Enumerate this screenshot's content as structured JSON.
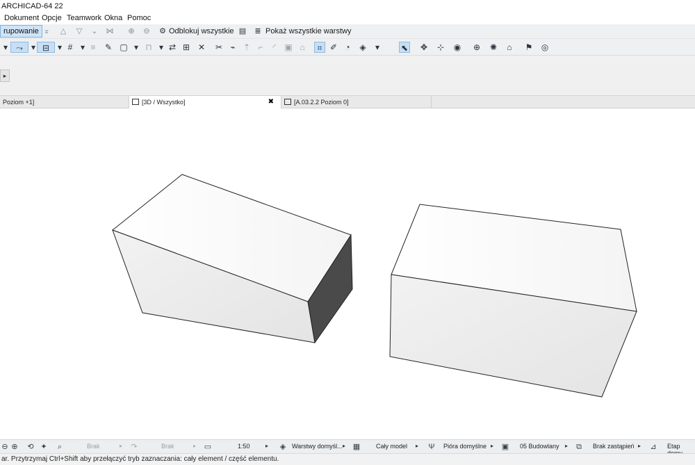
{
  "window": {
    "title": "ARCHICAD-64 22"
  },
  "menu": [
    "Dokument",
    "Opcje",
    "Teamwork",
    "Okna",
    "Pomoc"
  ],
  "toolbar1": {
    "group_button": "rupowanie",
    "unlock_all": "Odblokuj wszystkie",
    "show_all_layers": "Pokaż wszystkie warstwy"
  },
  "tabs": [
    {
      "label": "Poziom +1]",
      "active": false
    },
    {
      "label": "[3D / Wszystko]",
      "active": true,
      "close": "✖"
    },
    {
      "label": "[A.03.2.2 Poziom 0]",
      "active": false
    }
  ],
  "status": {
    "undo_field": "Brak",
    "redo_field": "Brak",
    "scale": "1:50",
    "layers": "Warstwy domyśl...",
    "model": "Cały model",
    "pens": "Pióra domyślne",
    "structure": "05 Budowlany",
    "override": "Brak zastąpień",
    "phase": "Etap domy"
  },
  "hint": "ar. Przytrzymaj Ctrl+Shift aby przełączyć tryb zaznaczania: cały element / część elementu.",
  "colors": {
    "selection_blue": "#cfe4f7",
    "toolbar_bg": "#eef0f2",
    "dark_face": "#4a4a4a"
  }
}
